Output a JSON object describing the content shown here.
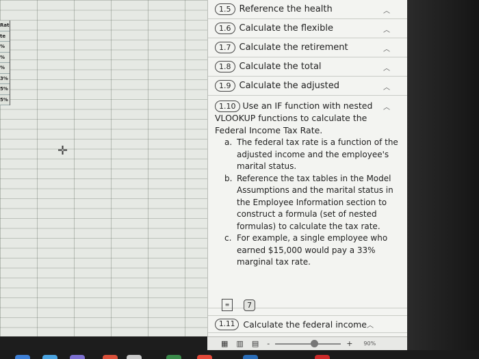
{
  "sheet": {
    "rate_cells": [
      "Rate",
      "te",
      "%",
      "%",
      "%",
      "3%",
      "5%",
      "5%"
    ]
  },
  "pane": {
    "steps_top": [
      {
        "number": "1.5",
        "label": "Reference the health"
      },
      {
        "number": "1.6",
        "label": "Calculate the flexible"
      },
      {
        "number": "1.7",
        "label": "Calculate the retirement"
      },
      {
        "number": "1.8",
        "label": "Calculate the total"
      },
      {
        "number": "1.9",
        "label": "Calculate the adjusted"
      }
    ],
    "expanded_step": {
      "number": "1.10",
      "intro": "Use an IF function with nested VLOOKUP functions to calculate the Federal Income Tax Rate.",
      "items": [
        {
          "marker": "a.",
          "text": "The federal tax rate is a function of the adjusted income and the employee's marital status."
        },
        {
          "marker": "b.",
          "text": "Reference the tax tables in the Model Assumptions and the marital status in the Employee Information section to construct a formula (set of nested formulas) to calculate the tax rate."
        },
        {
          "marker": "c.",
          "text": "For example, a single employee who earned $15,000 would pay a 33% marginal tax rate."
        }
      ]
    },
    "resource_count": "7",
    "step_bottom": {
      "number": "1.11",
      "label": "Calculate the federal income"
    }
  },
  "statusbar": {
    "zoom_minus": "-",
    "zoom_plus": "+",
    "zoom_label": "90%",
    "zoom_level": 0.6
  },
  "icons": {
    "chevron": "chevron-up-icon",
    "cursor": "cell-cursor-cross-icon",
    "document": "document-icon"
  },
  "colors": {
    "sheet_bg": "#e6e9e4",
    "pane_bg": "#f3f4f1"
  }
}
